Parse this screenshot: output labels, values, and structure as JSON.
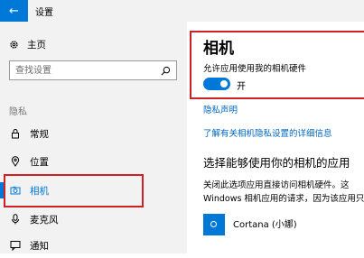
{
  "window": {
    "title": "设置"
  },
  "sidebar": {
    "home_label": "主页",
    "search_placeholder": "查找设置",
    "section_label": "隐私",
    "items": [
      {
        "label": "常规",
        "icon": "lock-icon"
      },
      {
        "label": "位置",
        "icon": "location-icon"
      },
      {
        "label": "相机",
        "icon": "camera-icon",
        "active": true
      },
      {
        "label": "麦克风",
        "icon": "microphone-icon"
      },
      {
        "label": "通知",
        "icon": "notification-icon"
      }
    ]
  },
  "main": {
    "title": "相机",
    "allow_label": "允许应用使用我的相机硬件",
    "toggle_state": "开",
    "privacy_link": "隐私声明",
    "learn_more_link": "了解有关相机隐私设置的详细信息",
    "choose_heading": "选择能够使用你的相机的应用",
    "desc_line1": "关闭此选项应用直接访问相机硬件。这",
    "desc_line2": "Windows 相机应用的请求，因为该应用只",
    "apps": [
      {
        "name": "Cortana (小娜)"
      }
    ]
  },
  "colors": {
    "accent": "#0078d7",
    "highlight_box": "#d11f27",
    "link": "#0067c0"
  }
}
